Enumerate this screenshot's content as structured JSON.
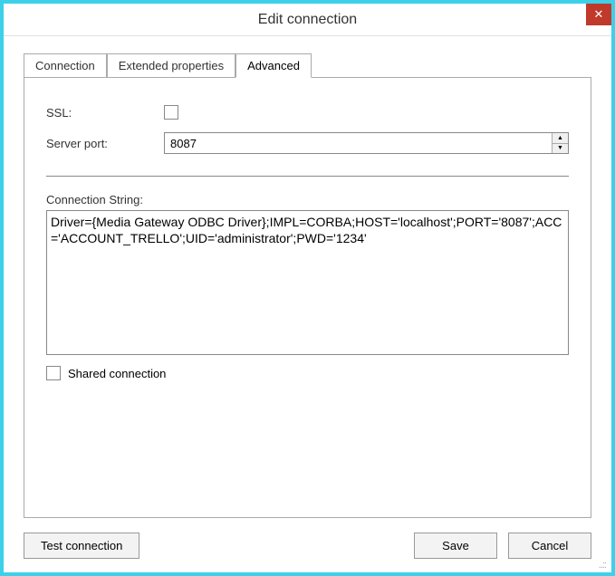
{
  "window": {
    "title": "Edit connection"
  },
  "tabs": {
    "connection": "Connection",
    "extended": "Extended properties",
    "advanced": "Advanced"
  },
  "form": {
    "ssl_label": "SSL:",
    "ssl_checked": false,
    "server_port_label": "Server port:",
    "server_port_value": "8087",
    "connection_string_label": "Connection String:",
    "connection_string_value": "Driver={Media Gateway ODBC Driver};IMPL=CORBA;HOST='localhost';PORT='8087';ACC='ACCOUNT_TRELLO';UID='administrator';PWD='1234'",
    "shared_label": "Shared connection",
    "shared_checked": false
  },
  "buttons": {
    "test": "Test connection",
    "save": "Save",
    "cancel": "Cancel"
  }
}
